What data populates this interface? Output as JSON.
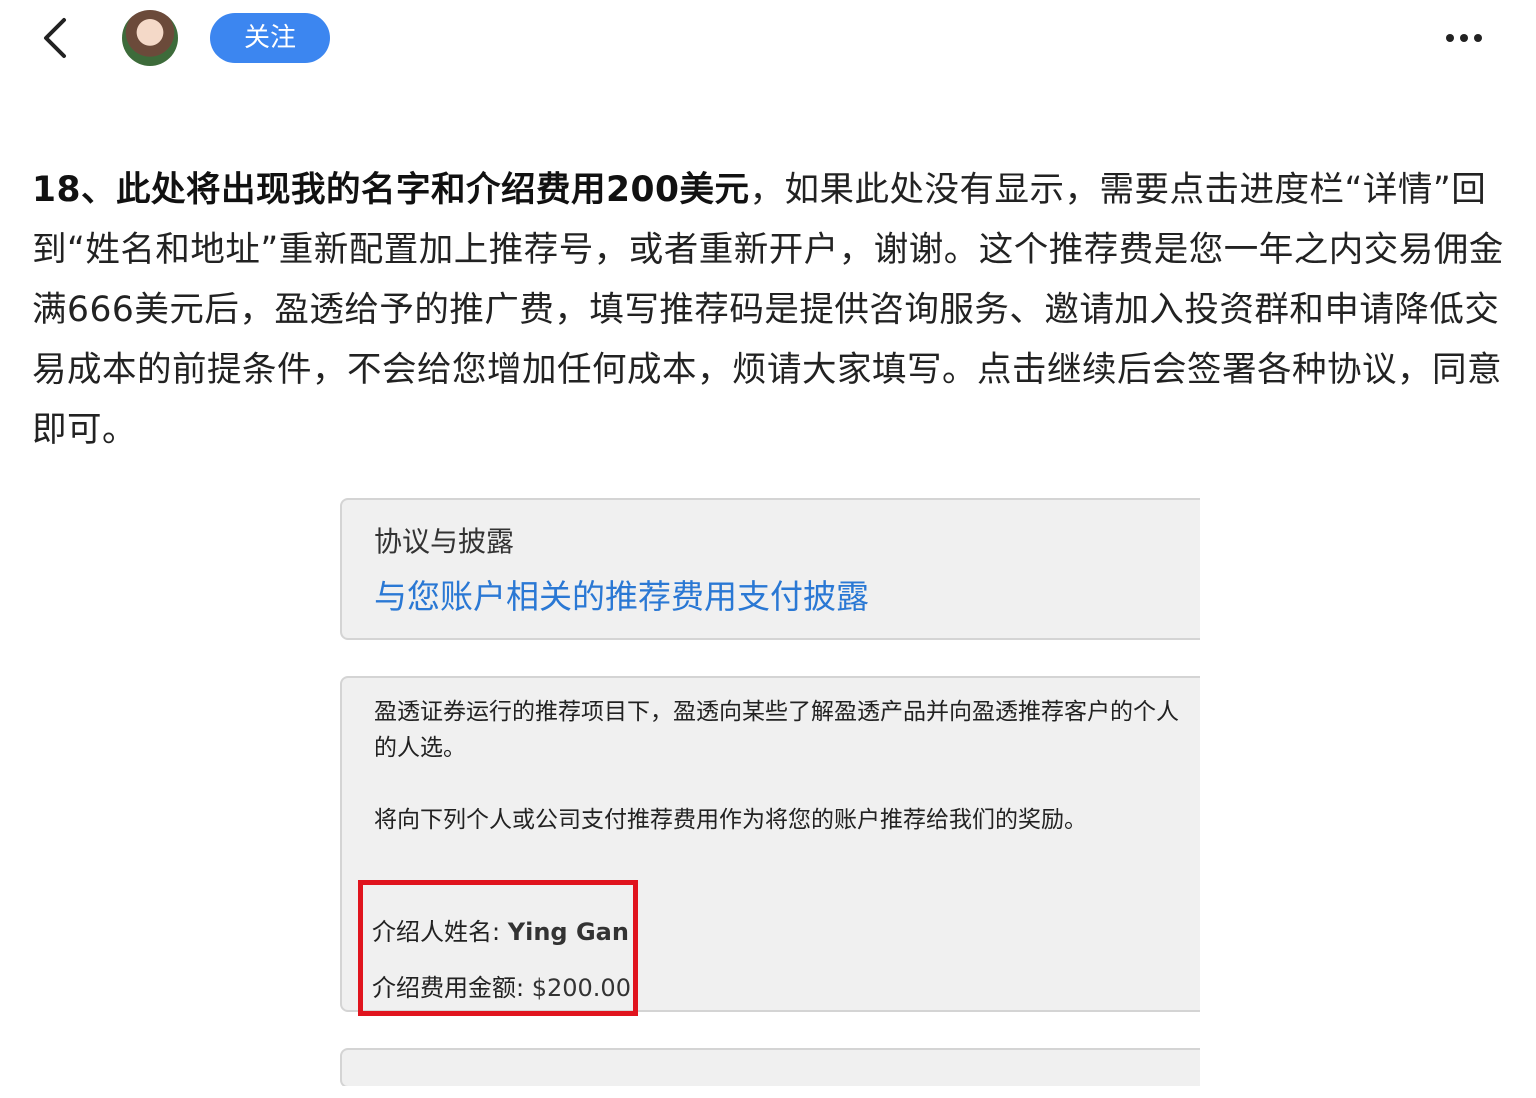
{
  "header": {
    "follow_label": "关注",
    "back_icon": "chevron-left-icon",
    "more_icon": "more-horizontal-icon"
  },
  "article": {
    "bold_text": "18、此处将出现我的名字和介绍费用200美元",
    "body_text": "，如果此处没有显示，需要点击进度栏“详情”回到“姓名和地址”重新配置加上推荐号，或者重新开户，谢谢。这个推荐费是您一年之内交易佣金满666美元后，盈透给予的推广费，填写推荐码是提供咨询服务、邀请加入投资群和申请降低交易成本的前提条件，不会给您增加任何成本，烦请大家填写。点击继续后会签署各种协议，同意即可。"
  },
  "screenshot": {
    "section_title": "协议与披露",
    "link_text": "与您账户相关的推荐费用支付披露",
    "para1_line1": "盈透证券运行的推荐项目下，盈透向某些了解盈透产品并向盈透推荐客户的个人",
    "para1_line2": "的人选。",
    "para2": "将向下列个人或公司支付推荐费用作为将您的账户推荐给我们的奖励。",
    "referrer_label": "介绍人姓名: ",
    "referrer_value": "Ying Gan",
    "fee_label": "介绍费用金额: ",
    "fee_value": "$200.00",
    "highlight_color": "#e0141e"
  },
  "colors": {
    "follow_button": "#3c86f0",
    "link": "#2a78d4"
  }
}
